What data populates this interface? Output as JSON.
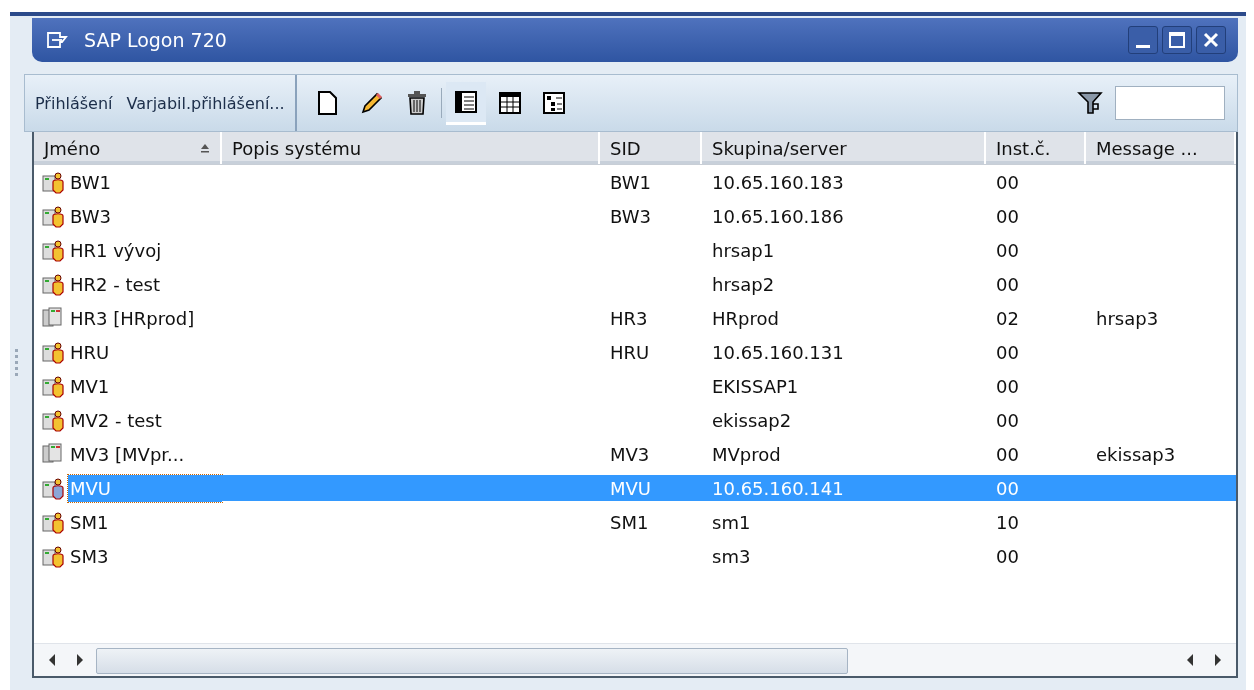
{
  "window": {
    "title": "SAP Logon 720"
  },
  "toolbar": {
    "actions": [
      "Přihlášení",
      "Varjabil.přihlášení..."
    ],
    "views": [
      {
        "selected": true
      },
      {
        "selected": false
      },
      {
        "selected": false
      }
    ]
  },
  "table": {
    "columns": [
      {
        "label": "Jméno",
        "sorted": true
      },
      {
        "label": "Popis systému",
        "sorted": false
      },
      {
        "label": "SID",
        "sorted": false
      },
      {
        "label": "Skupina/server",
        "sorted": false
      },
      {
        "label": "Inst.č.",
        "sorted": false
      },
      {
        "label": "Message ...",
        "sorted": false
      }
    ],
    "rows": [
      {
        "kind": "server",
        "selected": false,
        "cells": [
          "BW1",
          "",
          "BW1",
          "10.65.160.183",
          "00",
          ""
        ]
      },
      {
        "kind": "server",
        "selected": false,
        "cells": [
          "BW3",
          "",
          "BW3",
          "10.65.160.186",
          "00",
          ""
        ]
      },
      {
        "kind": "server",
        "selected": false,
        "cells": [
          "HR1 vývoj",
          "",
          "",
          "hrsap1",
          "00",
          ""
        ]
      },
      {
        "kind": "server",
        "selected": false,
        "cells": [
          "HR2 - test",
          "",
          "",
          "hrsap2",
          "00",
          ""
        ]
      },
      {
        "kind": "group",
        "selected": false,
        "cells": [
          "HR3 [HRprod]",
          "",
          "HR3",
          "HRprod",
          "02",
          "hrsap3"
        ]
      },
      {
        "kind": "server",
        "selected": false,
        "cells": [
          "HRU",
          "",
          "HRU",
          "10.65.160.131",
          "00",
          ""
        ]
      },
      {
        "kind": "server",
        "selected": false,
        "cells": [
          "MV1",
          "",
          "",
          "EKISSAP1",
          "00",
          ""
        ]
      },
      {
        "kind": "server",
        "selected": false,
        "cells": [
          "MV2 - test",
          "",
          "",
          "ekissap2",
          "00",
          ""
        ]
      },
      {
        "kind": "group",
        "selected": false,
        "cells": [
          "MV3 [MVpr...",
          "",
          "MV3",
          "MVprod",
          "00",
          "ekissap3"
        ]
      },
      {
        "kind": "server",
        "selected": true,
        "cells": [
          "MVU",
          "",
          "MVU",
          "10.65.160.141",
          "00",
          ""
        ]
      },
      {
        "kind": "server",
        "selected": false,
        "cells": [
          "SM1",
          "",
          "SM1",
          "sm1",
          "10",
          ""
        ]
      },
      {
        "kind": "server",
        "selected": false,
        "cells": [
          "SM3",
          "",
          "",
          "sm3",
          "00",
          ""
        ]
      }
    ]
  }
}
